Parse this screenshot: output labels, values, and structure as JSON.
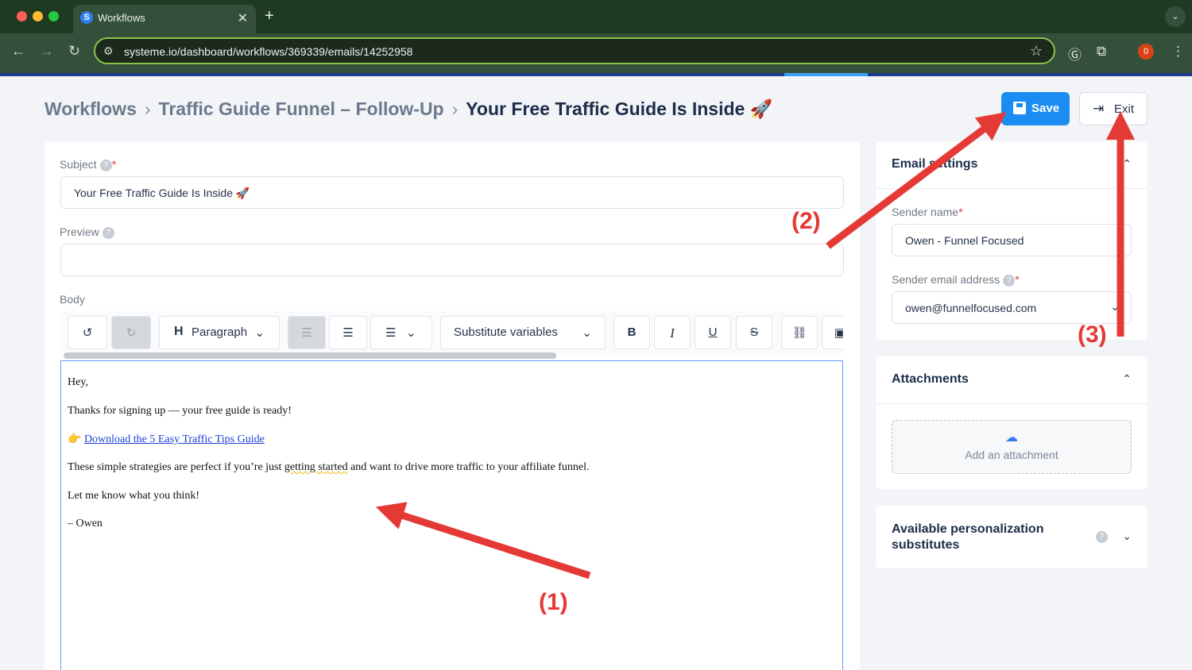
{
  "browser": {
    "tab_title": "Workflows",
    "url": "systeme.io/dashboard/workflows/369339/emails/14252958",
    "profile_badge": "0"
  },
  "breadcrumb": {
    "items": [
      "Workflows",
      "Traffic Guide Funnel – Follow-Up",
      "Your Free Traffic Guide Is Inside 🚀"
    ]
  },
  "actions": {
    "save_label": "Save",
    "exit_label": "Exit"
  },
  "form": {
    "subject_label": "Subject",
    "subject_value": "Your Free Traffic Guide Is Inside 🚀",
    "preview_label": "Preview",
    "preview_value": "",
    "body_label": "Body"
  },
  "toolbar": {
    "block_format": "Paragraph",
    "substitute_label": "Substitute variables"
  },
  "body": {
    "line1": "Hey,",
    "line2": "Thanks for signing up — your free guide is ready!",
    "link_prefix": "👉",
    "link_text": "Download the 5 Easy Traffic Tips Guide",
    "line4_a": "These simple strategies are perfect if you’re just ",
    "line4_b": "getting started",
    "line4_c": " and want to drive more traffic to your affiliate funnel.",
    "line5": "Let me know what you think!",
    "line6": "– Owen"
  },
  "email_settings": {
    "title": "Email settings",
    "sender_name_label": "Sender name",
    "sender_name_value": "Owen - Funnel Focused",
    "sender_email_label": "Sender email address",
    "sender_email_value": "owen@funnelfocused.com"
  },
  "attachments": {
    "title": "Attachments",
    "add_label": "Add an attachment"
  },
  "personalization": {
    "title_line1": "Available personalization",
    "title_line2": "substitutes"
  },
  "annotations": {
    "label1": "(1)",
    "label2": "(2)",
    "label3": "(3)",
    "color": "#e53935"
  }
}
